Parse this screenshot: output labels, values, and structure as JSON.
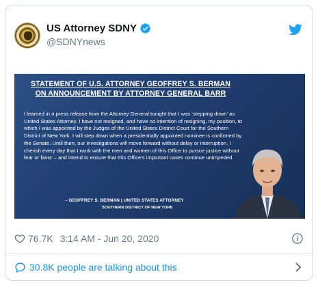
{
  "tweet": {
    "display_name": "US Attorney SDNY",
    "handle": "@SDNYnews",
    "media": {
      "headline_line1": "STATEMENT OF U.S. ATTORNEY GEOFFREY S. BERMAN",
      "headline_line2": "ON ANNOUNCEMENT BY ATTORNEY GENERAL BARR",
      "statement": "I learned in a press release from the Attorney General tonight that I was ‘stepping down’ as United States Attorney.  I have not resigned, and have no intention of resigning, my position, to which I was appointed by the Judges of the United States District Court for the Southern District of New York.  I will step down when a presidentially appointed nominee is confirmed by the Senate.  Until then, our investigations will move forward without delay or interruption.  I cherish every day that I work with the men and women of this Office to pursue justice without fear or favor – and intend to ensure that this Office’s important cases continue unimpeded.",
      "signature_line1": "– GEOFFREY S. BERMAN | UNITED STATES ATTORNEY",
      "signature_line2": "SOUTHERN DISTRICT OF NEW YORK"
    },
    "likes": "76.7K",
    "timestamp": "3:14 AM - Jun 20, 2020",
    "talking": "30.8K people are talking about this"
  },
  "colors": {
    "accent": "#1da1f2",
    "link": "#1b95e0",
    "muted": "#657786",
    "media_bg": "#1f3d6f"
  },
  "icons": {
    "verified": "verified-badge-icon",
    "platform": "twitter-bird-icon",
    "like": "heart-icon",
    "info": "info-icon",
    "reply": "speech-bubble-icon",
    "more": "chevron-right-icon"
  }
}
